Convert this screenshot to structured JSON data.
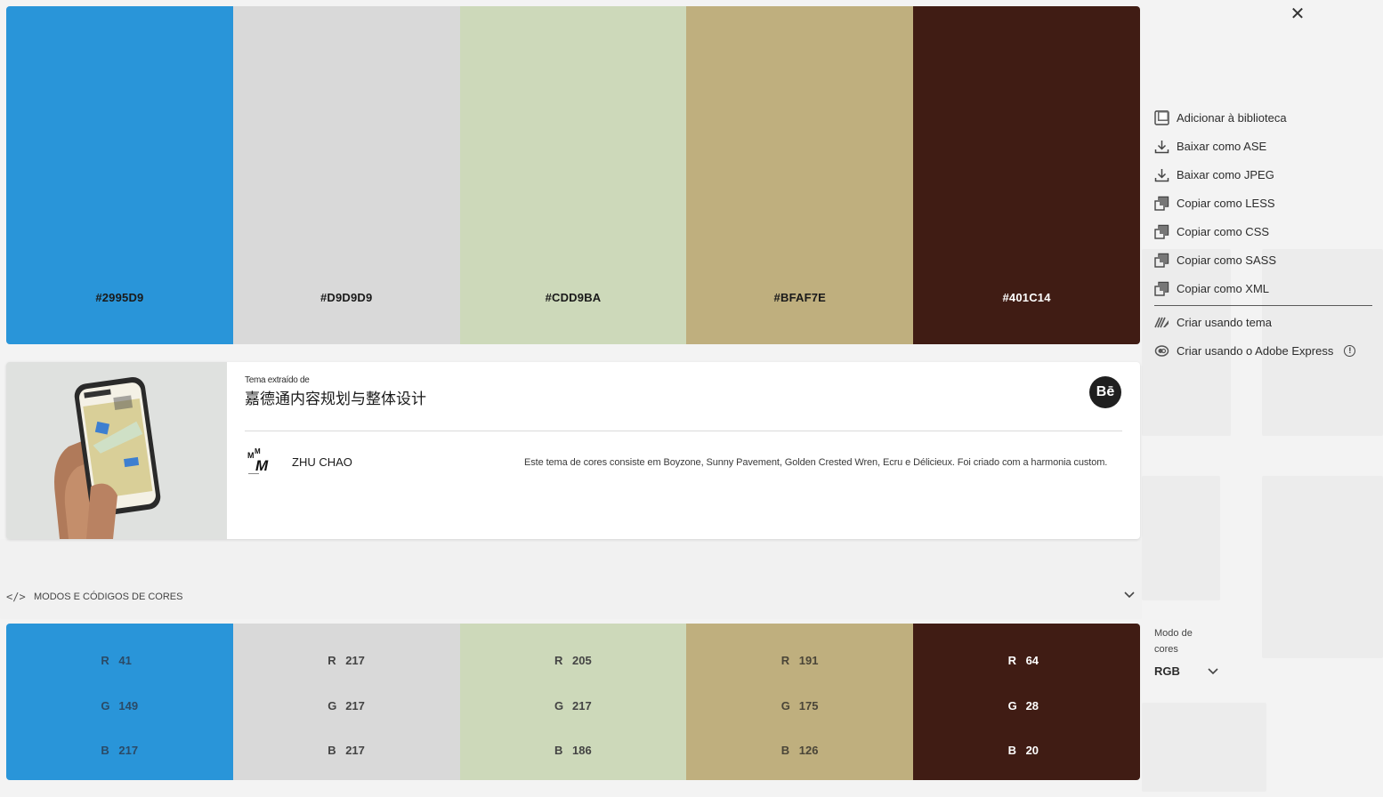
{
  "palette": {
    "swatches": [
      {
        "hex": "#2995D9",
        "color": "#2995D9",
        "text_color": "#1a1a1a",
        "rgb": {
          "r": "41",
          "g": "149",
          "b": "217"
        }
      },
      {
        "hex": "#D9D9D9",
        "color": "#D9D9D9",
        "text_color": "#1a1a1a",
        "rgb": {
          "r": "217",
          "g": "217",
          "b": "217"
        }
      },
      {
        "hex": "#CDD9BA",
        "color": "#CDD9BA",
        "text_color": "#1a1a1a",
        "rgb": {
          "r": "205",
          "g": "217",
          "b": "186"
        }
      },
      {
        "hex": "#BFAF7E",
        "color": "#BFAF7E",
        "text_color": "#1a1a1a",
        "rgb": {
          "r": "191",
          "g": "175",
          "b": "126"
        }
      },
      {
        "hex": "#401C14",
        "color": "#401C14",
        "text_color": "#ffffff",
        "rgb": {
          "r": "64",
          "g": "28",
          "b": "20"
        }
      }
    ]
  },
  "theme_info": {
    "extracted_label": "Tema extraído de",
    "project_title": "嘉德通内容规划与整体设计",
    "behance_badge": "Bē",
    "author_name": "ZHU CHAO",
    "description": "Este tema de cores consiste em Boyzone, Sunny Pavement, Golden Crested Wren, Ecru e Délicieux. Foi criado com a harmonia custom."
  },
  "modes_section": {
    "label": "MODOS E CÓDIGOS DE CORES",
    "code_icon": "</>",
    "channel_labels": {
      "r": "R",
      "g": "G",
      "b": "B"
    }
  },
  "side_panel": {
    "close": "✕",
    "menu": [
      {
        "label": "Adicionar à biblioteca",
        "icon": "library-icon"
      },
      {
        "label": "Baixar como ASE",
        "icon": "download-icon"
      },
      {
        "label": "Baixar como JPEG",
        "icon": "download-icon"
      },
      {
        "label": "Copiar como LESS",
        "icon": "copy-icon"
      },
      {
        "label": "Copiar como CSS",
        "icon": "copy-icon"
      },
      {
        "label": "Copiar como SASS",
        "icon": "copy-icon"
      },
      {
        "label": "Copiar como XML",
        "icon": "copy-icon"
      }
    ],
    "menu_secondary": [
      {
        "label": "Criar usando tema",
        "icon": "create-theme-icon"
      },
      {
        "label": "Criar usando o Adobe Express",
        "icon": "adobe-express-icon"
      }
    ],
    "color_mode_label": "Modo de cores",
    "color_mode_value": "RGB"
  }
}
